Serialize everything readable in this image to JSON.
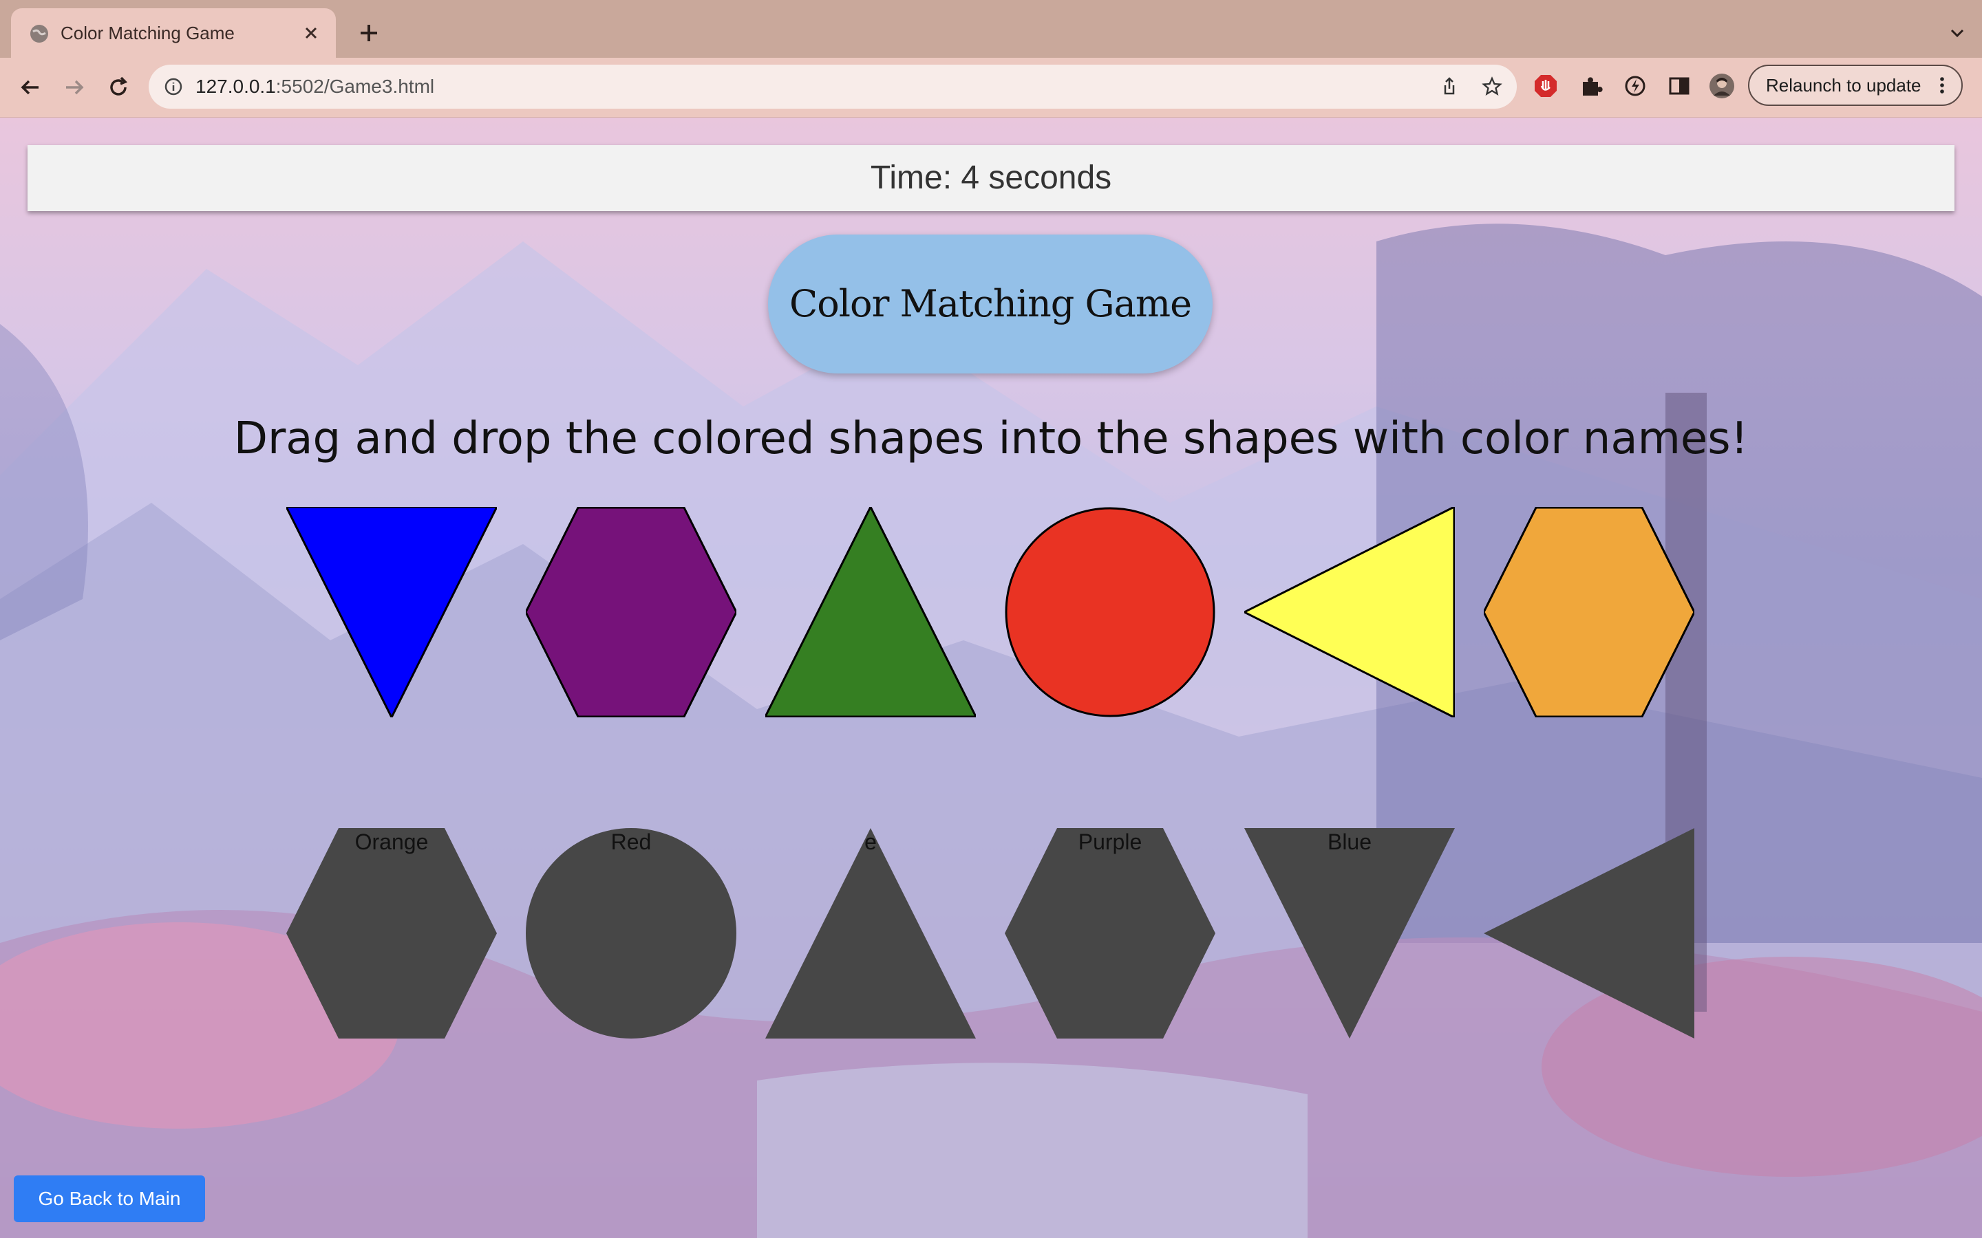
{
  "browser": {
    "tab_title": "Color Matching Game",
    "url_host": "127.0.0.1",
    "url_path": ":5502/Game3.html",
    "relaunch_label": "Relaunch to update"
  },
  "game": {
    "timer_text": "Time: 4 seconds",
    "title": "Color Matching Game",
    "instructions": "Drag and drop the colored shapes into the shapes with color names!",
    "colored_shapes": [
      {
        "shape": "triangle-down",
        "color": "#0000ff"
      },
      {
        "shape": "hexagon",
        "color": "#76127a"
      },
      {
        "shape": "triangle-up",
        "color": "#357f22"
      },
      {
        "shape": "circle",
        "color": "#e93323"
      },
      {
        "shape": "triangle-left",
        "color": "#ffff55"
      },
      {
        "shape": "hexagon",
        "color": "#f0a73b"
      }
    ],
    "target_slots": [
      {
        "shape": "hexagon",
        "label": "Orange"
      },
      {
        "shape": "circle",
        "label": "Red"
      },
      {
        "shape": "triangle-up",
        "label": "e"
      },
      {
        "shape": "hexagon",
        "label": "Purple"
      },
      {
        "shape": "triangle-down",
        "label": "Blue"
      },
      {
        "shape": "triangle-left",
        "label": ""
      }
    ],
    "slot_color": "#474747",
    "back_button": "Go Back to Main"
  }
}
